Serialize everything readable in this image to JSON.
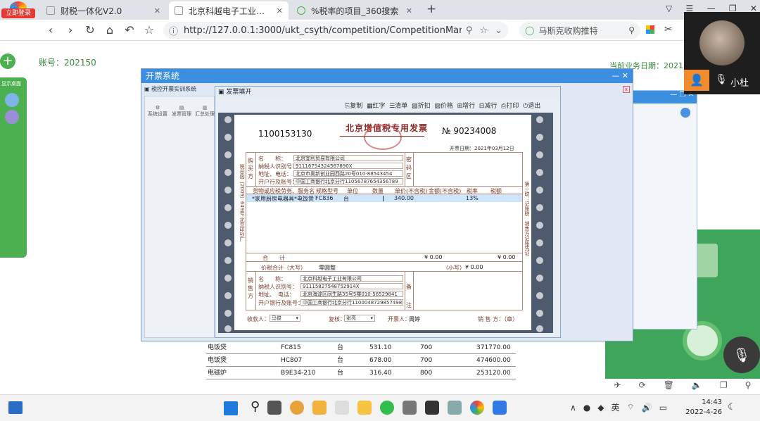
{
  "browser": {
    "login_badge": "立即登录",
    "tabs": [
      {
        "label": "财税一体化V2.0"
      },
      {
        "label": "北京科越电子工业有限公司（",
        "active": true
      },
      {
        "label": "%税率的项目_360搜索"
      }
    ],
    "new_tab": "+",
    "url": "http://127.0.0.1:3000/ukt_csyth/competition/CompetitionManage",
    "search_text": "马斯克收购推特"
  },
  "page": {
    "account": "账号：202150",
    "business_date": "当前业务日期：2021年",
    "sidebar_label": "显示桌面"
  },
  "video_call": {
    "user": "小杜"
  },
  "dialog": {
    "title": "开票系统",
    "sub_title": "税控开票实训系统",
    "tools": [
      "系统设置",
      "发票管理",
      "汇总处理"
    ]
  },
  "invoice_window": {
    "title": "发票填开",
    "toolbar": [
      "复制",
      "红字",
      "清单",
      "折扣",
      "价格",
      "增行",
      "减行",
      "打印",
      "退出"
    ]
  },
  "invoice": {
    "code": "1100153130",
    "heading": "北京增值税专用发票",
    "number_prefix": "№",
    "number": "90234008",
    "date": "开票日期：2021年03月12日",
    "buyer": {
      "side_label": "购买方",
      "name_label": "名　　称：",
      "name": "北京宜利贸易有限公司",
      "tax_label": "纳税人识别号：",
      "tax_id": "91116754324567890X",
      "addr_label": "地址、电话：",
      "addr": "北京市奥新创业园西路20号010-88543454",
      "bank_label": "开户行及账号：",
      "bank": "中国工商银行北京分行11056787654356789"
    },
    "secret_label": "密码区",
    "columns": [
      "货物或应税劳务、服务名称",
      "规格型号",
      "单位",
      "数量",
      "单价(不含税)",
      "金额(不含税)",
      "税率",
      "税额"
    ],
    "items": [
      {
        "name": "*家用厨房电器具*电饭煲",
        "model": "FC836",
        "unit": "台",
        "qty": "",
        "price": "340.00",
        "amount": "",
        "rate": "13%",
        "tax": ""
      }
    ],
    "total_label": "合　　计",
    "total_amount": "¥ 0.00",
    "total_tax": "¥ 0.00",
    "grand_label": "价税合计（大写）",
    "grand_upper": "零圆整",
    "grand_small_label": "（小写）",
    "grand_small": "¥ 0.00",
    "seller": {
      "side_label": "销售方",
      "name_label": "名　　称：",
      "name": "北京科越电子工业有限公司",
      "tax_label": "纳税人识别号：",
      "tax_id": "91115827548752914X",
      "addr_label": "地址、　电话：",
      "addr": "北京海淀区同生路35号5楼010-56529841",
      "bank_label": "开户银行及账号：",
      "bank": "中国工商银行北京分行110004872985749811"
    },
    "remark_label": "备注",
    "payee_label": "收款人：",
    "payee": "马俊",
    "reviewer_label": "复核：",
    "reviewer": "张亮",
    "drawer_label": "开票人：",
    "drawer": "周婷",
    "seller_seal_label": "销 售 方：（章）",
    "left_vertical": "税总函〔2009〕649号 北京印钞厂",
    "right_vertical": "第一联：记账联　销售方记账凭证"
  },
  "background_table": {
    "rows": [
      {
        "name": "电饭煲",
        "model": "FC815",
        "unit": "台",
        "price": "531.10",
        "qty": "700",
        "amount": "371770.00"
      },
      {
        "name": "电饭煲",
        "model": "HC807",
        "unit": "台",
        "price": "678.00",
        "qty": "700",
        "amount": "474600.00"
      },
      {
        "name": "电磁炉",
        "model": "B9E34-210",
        "unit": "台",
        "price": "316.40",
        "qty": "800",
        "amount": "253120.00"
      }
    ]
  },
  "taskbar": {
    "ime": "英",
    "time": "14:43",
    "date": "2022-4-26"
  }
}
